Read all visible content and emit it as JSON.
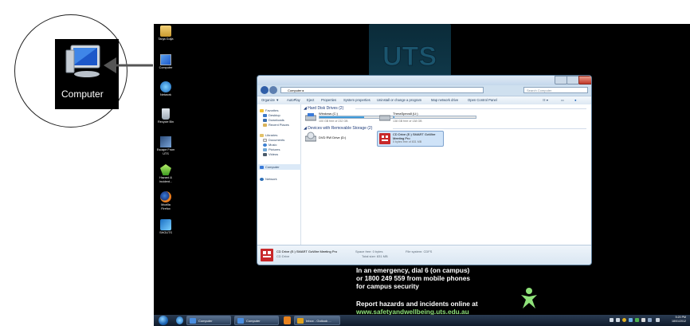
{
  "callout": {
    "label": "Computer",
    "icon": "computer-icon"
  },
  "desktop_icons": [
    {
      "label": "Tanja Golja",
      "icon": "user-folder-icon"
    },
    {
      "label": "Computer",
      "icon": "computer-icon"
    },
    {
      "label": "Network",
      "icon": "network-icon"
    },
    {
      "label": "Recycle Bin",
      "icon": "recycle-bin-icon"
    },
    {
      "label": "Escape From\nUTS",
      "icon": "escape-icon"
    },
    {
      "label": "Hazard &\nIncident...",
      "icon": "hazard-icon"
    },
    {
      "label": "Mozilla\nFirefox",
      "icon": "firefox-icon"
    },
    {
      "label": "SHOUTS",
      "icon": "shouts-icon"
    }
  ],
  "wallpaper": {
    "emergency": [
      "In an emergency, dial 6 (on campus)",
      "or 1800 249 559 from mobile phones",
      "for campus security"
    ],
    "report": "Report hazards and incidents online at",
    "url": "www.safetyandwellbeing.uts.edu.au"
  },
  "window": {
    "address": "Computer",
    "search_placeholder": "Search Computer",
    "toolbar": [
      "Organize ▼",
      "AutoPlay",
      "Eject",
      "Properties",
      "System properties",
      "Uninstall or change a program",
      "Map network drive",
      "Open Control Panel"
    ],
    "nav": {
      "favorites": "Favorites",
      "desktop": "Desktop",
      "downloads": "Downloads",
      "recent": "Recent Places",
      "libraries": "Libraries",
      "documents": "Documents",
      "music": "Music",
      "pictures": "Pictures",
      "videos": "Videos",
      "computer": "Computer",
      "network": "Network"
    },
    "groups": {
      "hdd": "Hard Disk Drives (2)",
      "removable": "Devices with Removable Storage (2)"
    },
    "drives": {
      "c": {
        "name": "Windows (C:)",
        "free": "100 GB free of 232 GB",
        "used_fraction": 0.57
      },
      "u": {
        "name": "TheraSpecs8 (U:)",
        "free": "138 GB free of 138 GB",
        "used_fraction": 0.01
      },
      "dvd": {
        "name": "DVD RW Drive (D:)"
      },
      "cd": {
        "name": "CD Drive (E:) SMART GoWire",
        "name2": "Meeting Pro",
        "free": "0 bytes free of 831 MB"
      }
    },
    "details": {
      "title": "CD Drive (E:) SMART GoWire Meeting Pro",
      "type": "CD Drive",
      "space_free": "Space free: 0 bytes",
      "total_size": "Total size: 831 MB",
      "file_system": "File system: CDFS"
    }
  },
  "taskbar": {
    "buttons": [
      "Computer",
      "Computer",
      "Inbox - Outlook ..."
    ],
    "time": "5:20 PM",
    "date": "18/01/2012"
  },
  "colors": {
    "desktop": "#000000",
    "accent": "#2a86c9",
    "url_green": "#8fe27a"
  }
}
